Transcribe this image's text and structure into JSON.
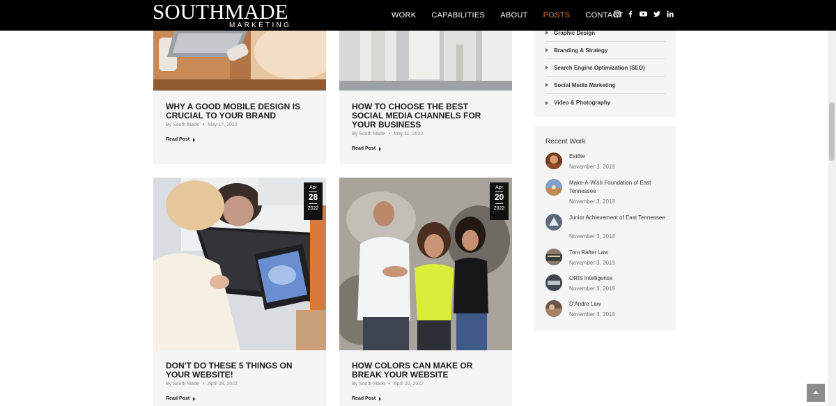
{
  "header": {
    "logo_main": "SOUTHMADE",
    "logo_sub": "MARKETING",
    "nav": [
      "WORK",
      "CAPABILITIES",
      "ABOUT",
      "POSTS",
      "CONTACT"
    ],
    "active_nav": "POSTS",
    "social_icons": [
      "instagram-icon",
      "facebook-icon",
      "youtube-icon",
      "twitter-icon",
      "linkedin-icon"
    ]
  },
  "posts": [
    {
      "title": "WHY A GOOD MOBILE DESIGN IS CRUCIAL TO YOUR BRAND",
      "author": "By South Made",
      "date": "May 17, 2022",
      "read_label": "Read Post"
    },
    {
      "title": "HOW TO CHOOSE THE BEST SOCIAL MEDIA CHANNELS FOR YOUR BUSINESS",
      "author": "By South Made",
      "date": "May 11, 2022",
      "read_label": "Read Post"
    },
    {
      "title": "DON'T DO THESE 5 THINGS ON YOUR WEBSITE!",
      "author": "By South Made",
      "date": "April 28, 2022",
      "read_label": "Read Post",
      "badge": {
        "month": "Apr",
        "day": "28",
        "year": "2022"
      }
    },
    {
      "title": "HOW COLORS CAN MAKE OR BREAK YOUR WEBSITE",
      "author": "By South Made",
      "date": "April 20, 2022",
      "read_label": "Read Post",
      "badge": {
        "month": "Apr",
        "day": "20",
        "year": "2022"
      }
    }
  ],
  "meta_separator": "•",
  "sidebar": {
    "categories": [
      "Graphic Design",
      "Branding & Strategy",
      "Search Engine Optimization (SEO)",
      "Social Media Marketing",
      "Video & Photography"
    ],
    "recent_work_title": "Recent Work",
    "recent_work": [
      {
        "name": "Est8te",
        "date": "November 3, 2018"
      },
      {
        "name": "Make-A-Wish Foundation of East Tennessee",
        "date": "November 3, 2018"
      },
      {
        "name": "Junior Achievement of East Tennessee",
        "date": "November 3, 2018"
      },
      {
        "name": "Tom Rafter Law",
        "date": "November 3, 2018"
      },
      {
        "name": "ORIS Intelligence",
        "date": "November 3, 2018"
      },
      {
        "name": "D'Andre Law",
        "date": "November 3, 2018"
      }
    ]
  },
  "colors": {
    "header_bg": "#000000",
    "accent": "#e07b2a",
    "card_bg": "#f5f5f5"
  }
}
